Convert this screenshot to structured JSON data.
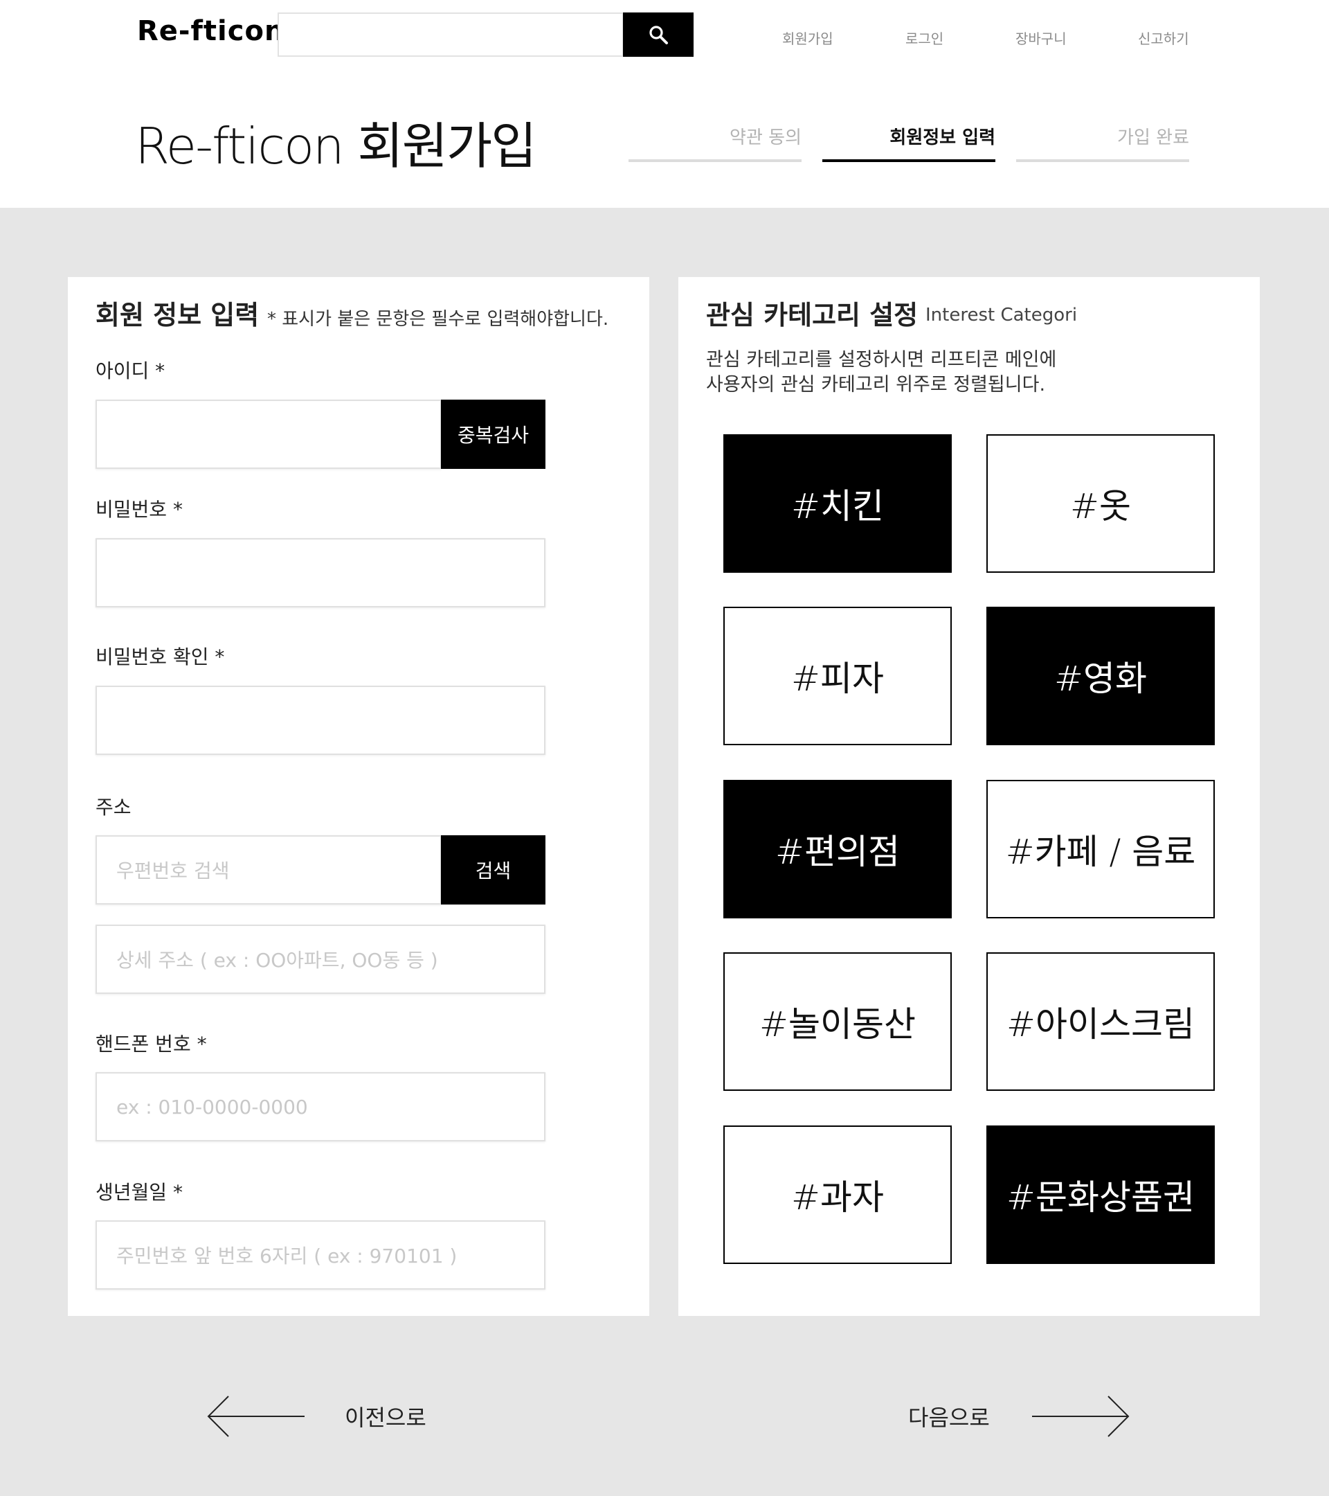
{
  "header": {
    "logo": "Re-fticon",
    "search_placeholder": "",
    "nav": [
      "회원가입",
      "로그인",
      "장바구니",
      "신고하기"
    ]
  },
  "page": {
    "title": "Re-fticon 회원가입",
    "steps": [
      {
        "label": "약관 동의",
        "state": "done"
      },
      {
        "label": "회원정보 입력",
        "state": "active"
      },
      {
        "label": "가입 완료",
        "state": "pending"
      }
    ]
  },
  "member_form": {
    "title": "회원 정보 입력",
    "note": "* 표시가 붙은 문항은 필수로 입력해야합니다.",
    "id_label": "아이디 *",
    "id_value": "",
    "dup_check_button": "중복검사",
    "password_label": "비밀번호 *",
    "password_confirm_label": "비밀번호 확인 *",
    "address_label": "주소",
    "postcode_placeholder": "우편번호 검색",
    "address_search_button": "검색",
    "address_detail_placeholder": "상세 주소 ( ex : OO아파트, OO동 등 )",
    "phone_label": "핸드폰 번호 *",
    "phone_placeholder": "ex : 010-0000-0000",
    "birth_label": "생년월일 *",
    "birth_placeholder": "주민번호 앞 번호 6자리 ( ex : 970101 )"
  },
  "category": {
    "title": "관심 카테고리 설정",
    "subtitle": "Interest Categori",
    "desc_line1": "관심 카테고리를 설정하시면 리프티콘 메인에",
    "desc_line2": "사용자의 관심 카테고리 위주로 정렬됩니다.",
    "tags": [
      {
        "label": "#치킨",
        "selected": true
      },
      {
        "label": "#옷",
        "selected": false
      },
      {
        "label": "#피자",
        "selected": false
      },
      {
        "label": "#영화",
        "selected": true
      },
      {
        "label": "#편의점",
        "selected": true
      },
      {
        "label": "#카페 / 음료",
        "selected": false
      },
      {
        "label": "#놀이동산",
        "selected": false
      },
      {
        "label": "#아이스크림",
        "selected": false
      },
      {
        "label": "#과자",
        "selected": false
      },
      {
        "label": "#문화상품권",
        "selected": true
      }
    ]
  },
  "footer_nav": {
    "prev": "이전으로",
    "next": "다음으로"
  },
  "colors": {
    "background": "#e6e6e6",
    "accent": "#000000",
    "muted_text": "#b3b3b3"
  }
}
